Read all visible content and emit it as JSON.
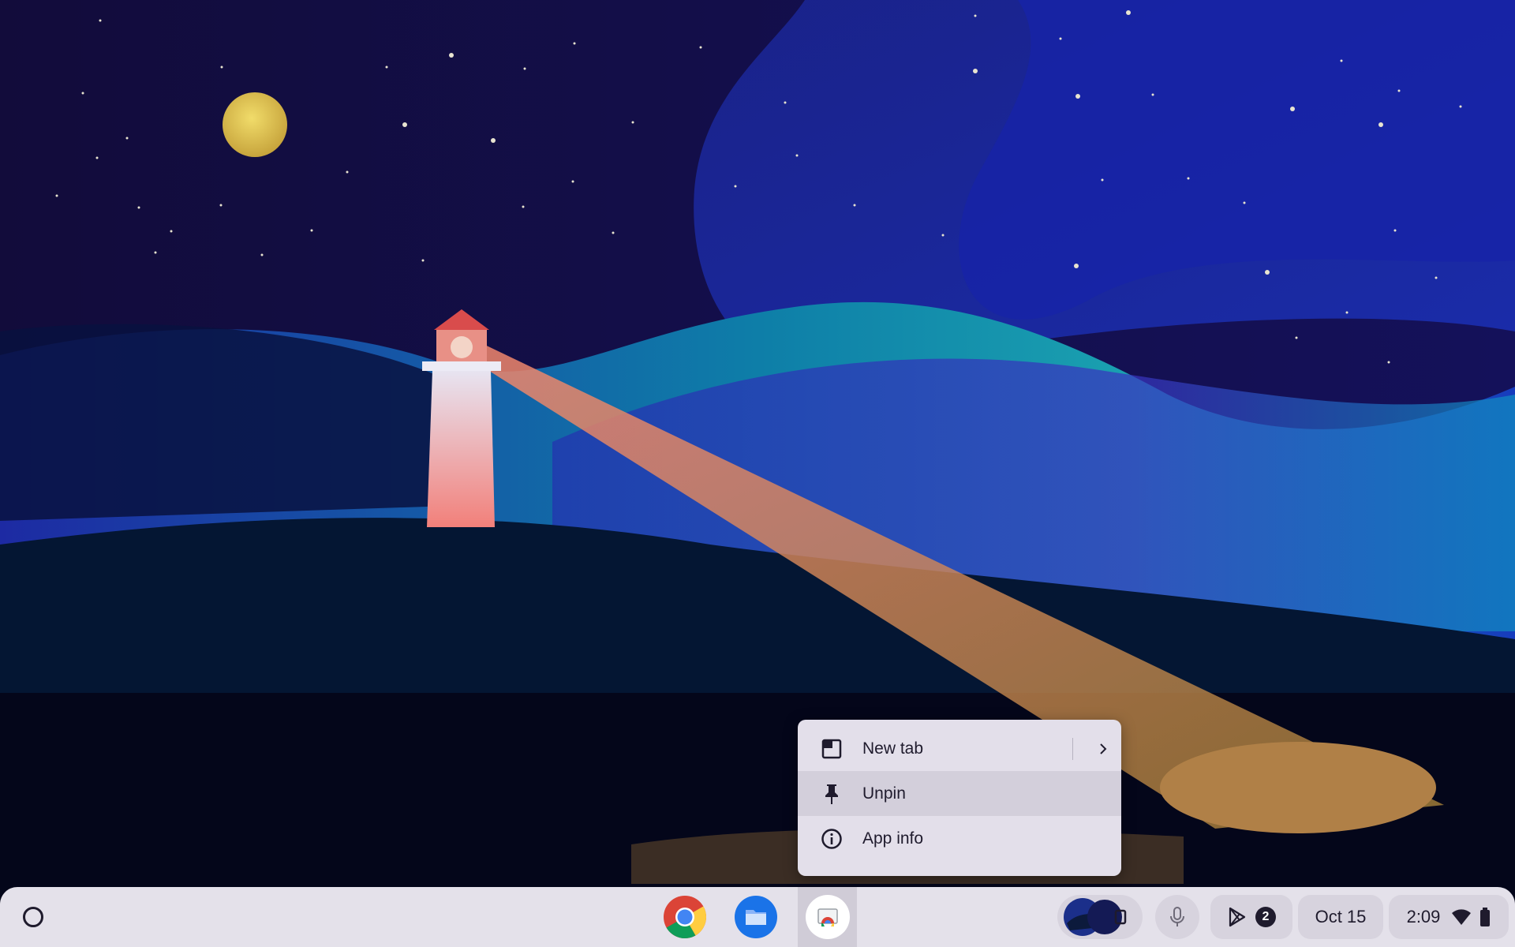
{
  "context_menu": {
    "items": [
      {
        "label": "New tab",
        "icon": "new-tab-icon",
        "has_submenu": true
      },
      {
        "label": "Unpin",
        "icon": "pin-icon",
        "has_submenu": false
      },
      {
        "label": "App info",
        "icon": "info-icon",
        "has_submenu": false
      }
    ]
  },
  "shelf": {
    "launcher_icon": "launcher-circle-icon",
    "pinned_apps": [
      {
        "name_icon": "chrome-icon"
      },
      {
        "name_icon": "files-icon"
      },
      {
        "name_icon": "chrome-web-app-icon",
        "active": true
      }
    ],
    "holding_space_icon": "holding-space-icon",
    "mic_icon": "microphone-icon",
    "notification_icon": "play-store-icon",
    "notification_count": "2",
    "date": "Oct 15",
    "time": "2:09",
    "wifi_icon": "wifi-icon",
    "battery_icon": "battery-icon"
  },
  "colors": {
    "sky": "#120c3a",
    "menu_bg": "#e3dfea",
    "shelf_bg": "#e4e1ea",
    "text": "#1f1b2d"
  }
}
